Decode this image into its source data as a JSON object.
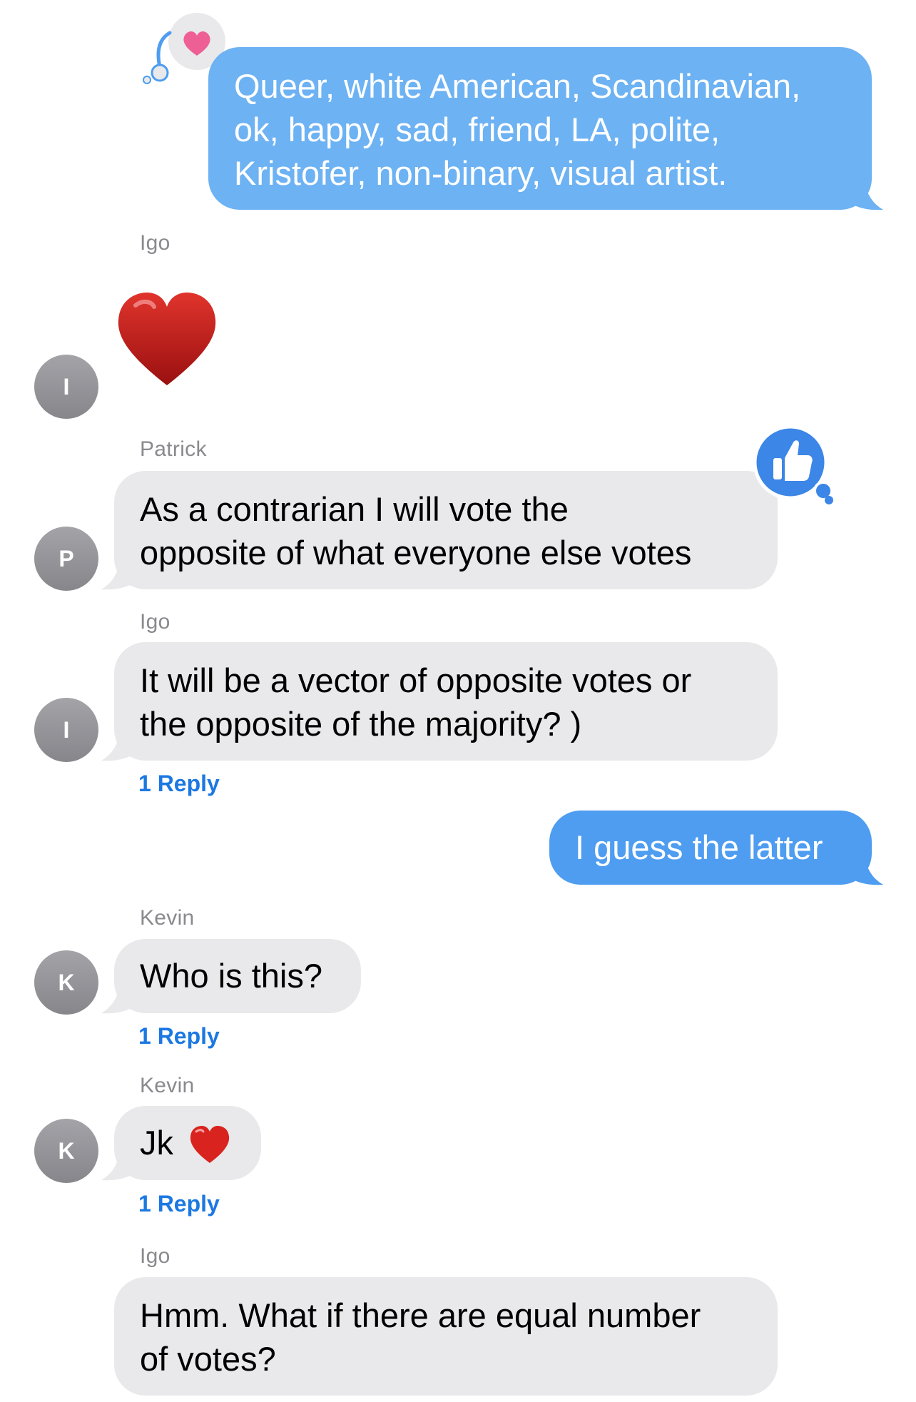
{
  "messages": [
    {
      "id": "m1",
      "from": "me",
      "text_lines": [
        "Queer, white American, Scandinavian,",
        "ok, happy, sad, friend, LA, polite,",
        "Kristofer, non-binary, visual artist."
      ],
      "tapback": "heart",
      "tapback_color": "#ee5f95"
    },
    {
      "id": "m2",
      "sender": "Igo",
      "avatar_initial": "I",
      "emoji": "heart"
    },
    {
      "id": "m3",
      "sender": "Patrick",
      "avatar_initial": "P",
      "text_lines": [
        "As a contrarian I will vote the",
        "opposite of what everyone else votes"
      ],
      "tapback": "thumbs-up"
    },
    {
      "id": "m4",
      "sender": "Igo",
      "avatar_initial": "I",
      "text_lines": [
        "It will be a vector of opposite votes or",
        "the opposite of the majority? )"
      ],
      "reply": "1 Reply"
    },
    {
      "id": "m5",
      "from": "me",
      "text": "I guess the latter"
    },
    {
      "id": "m6",
      "sender": "Kevin",
      "avatar_initial": "K",
      "text": "Who is this?",
      "reply": "1 Reply"
    },
    {
      "id": "m7",
      "sender": "Kevin",
      "avatar_initial": "K",
      "text": "Jk",
      "emoji": "heart",
      "reply": "1 Reply"
    },
    {
      "id": "m8",
      "sender": "Igo",
      "text_lines": [
        "Hmm. What if there are equal number",
        "of votes?"
      ]
    }
  ],
  "colors": {
    "outgoing_bubble": "#4e9df0",
    "incoming_bubble": "#e9e9eb",
    "reply_link": "#1c78e2",
    "heart": "#c81d1d"
  }
}
